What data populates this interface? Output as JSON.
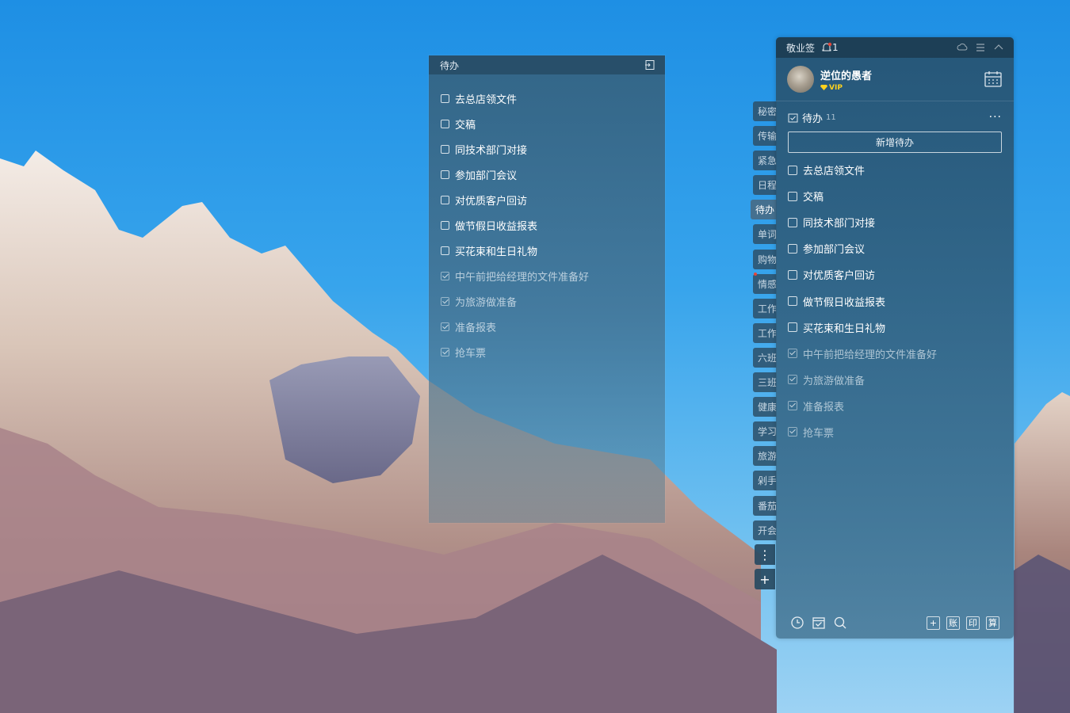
{
  "float_panel": {
    "title": "待办",
    "items": [
      {
        "text": "去总店领文件",
        "done": false
      },
      {
        "text": "交稿",
        "done": false
      },
      {
        "text": "同技术部门对接",
        "done": false
      },
      {
        "text": "参加部门会议",
        "done": false
      },
      {
        "text": "对优质客户回访",
        "done": false
      },
      {
        "text": "做节假日收益报表",
        "done": false
      },
      {
        "text": "买花束和生日礼物",
        "done": false
      },
      {
        "text": "中午前把给经理的文件准备好",
        "done": true
      },
      {
        "text": "为旅游做准备",
        "done": true
      },
      {
        "text": "准备报表",
        "done": true
      },
      {
        "text": "抢车票",
        "done": true
      }
    ]
  },
  "side_tabs": {
    "items": [
      "秘密",
      "传输",
      "紧急",
      "日程",
      "待办",
      "单词",
      "购物",
      "情感",
      "工作",
      "工作",
      "六班",
      "三班",
      "健康",
      "学习",
      "旅游",
      "剁手",
      "番茄",
      "开会"
    ],
    "active_index": 4,
    "more_label": "⋮",
    "add_label": "+"
  },
  "main": {
    "app_title": "敬业签",
    "notification_count": "1",
    "user": {
      "name": "逆位的愚者",
      "badge": "VIP"
    },
    "section": {
      "title": "待办",
      "count": "11",
      "more": "···"
    },
    "add_button": "新增待办",
    "items": [
      {
        "text": "去总店领文件",
        "done": false
      },
      {
        "text": "交稿",
        "done": false
      },
      {
        "text": "同技术部门对接",
        "done": false
      },
      {
        "text": "参加部门会议",
        "done": false
      },
      {
        "text": "对优质客户回访",
        "done": false
      },
      {
        "text": "做节假日收益报表",
        "done": false
      },
      {
        "text": "买花束和生日礼物",
        "done": false
      },
      {
        "text": "中午前把给经理的文件准备好",
        "done": true
      },
      {
        "text": "为旅游做准备",
        "done": true
      },
      {
        "text": "准备报表",
        "done": true
      },
      {
        "text": "抢车票",
        "done": true
      }
    ],
    "bottom_right": [
      "+",
      "账",
      "印",
      "算"
    ]
  },
  "colors": {
    "vip": "#ffd21e",
    "notif_dot": "#e2463a"
  }
}
